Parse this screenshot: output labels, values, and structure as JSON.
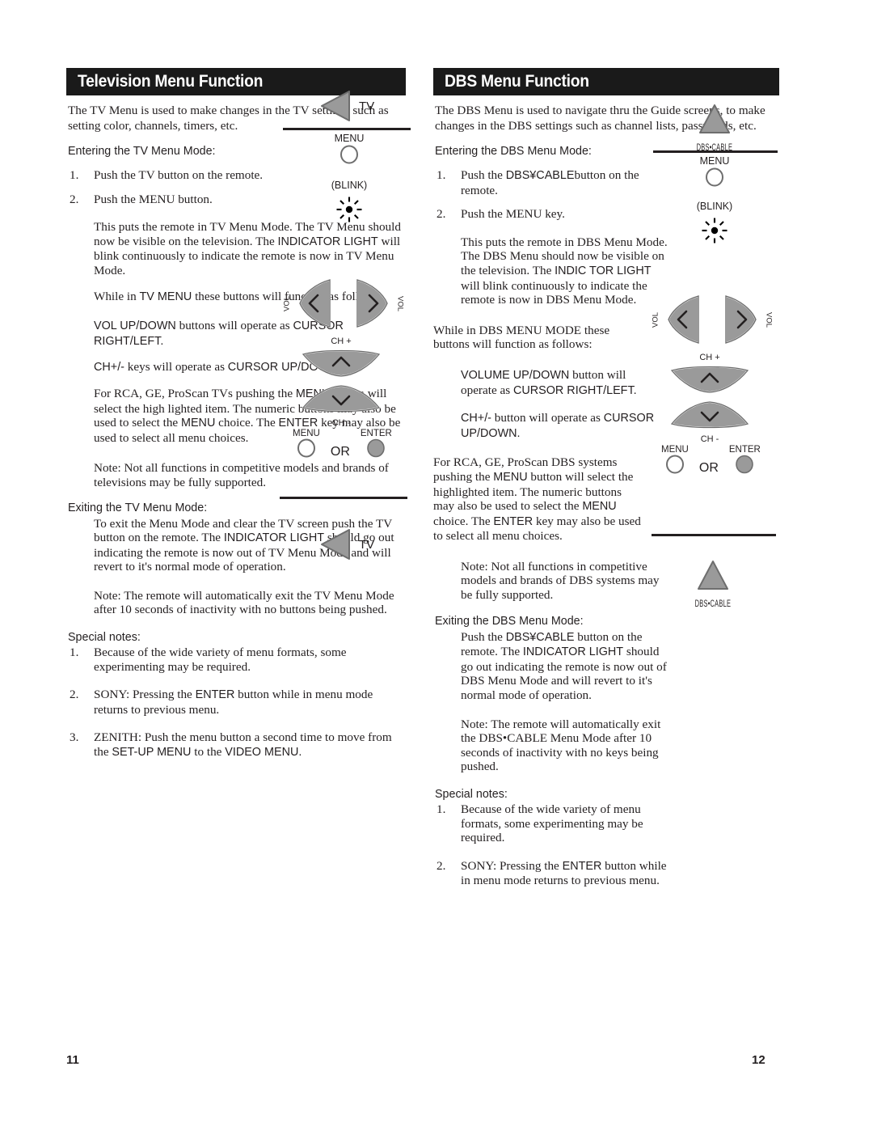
{
  "document": {
    "type": "remote-control-manual-spread"
  },
  "left_page": {
    "header": "Television Menu Function",
    "intro": "The TV Menu is used to make changes in the TV settings such as setting color, channels, timers, etc.",
    "entering_heading": "Entering the TV Menu Mode:",
    "step1_num": "1.",
    "step1": "Push the TV button on the remote.",
    "step2_num": "2.",
    "step2": "Push the MENU button.",
    "para_mode": "This puts the remote in TV Menu Mode. The TV  Menu should now be visible on the television. The ",
    "para_mode_b1": "INDICATOR LIGHT",
    "para_mode_cont": " will blink continuously to indicate the remote is now in TV Menu Mode.",
    "para_while_a": "While in ",
    "para_while_b": "TV MENU",
    "para_while_c": " these buttons will function as follows:",
    "para_vol_a": "VOL UP/DOWN",
    "para_vol_b": " buttons will operate as ",
    "para_vol_c": "CURSOR RIGHT/LEFT.",
    "para_ch_a": "CH+/-",
    "para_ch_b": " keys will operate as ",
    "para_ch_c": "CURSOR UP/DOWN.",
    "para_rca_1": "For RCA, GE, ProScan TVs pushing the ",
    "para_rca_menu": "MENU",
    "para_rca_2": " button will select the high lighted item. The numeric buttons may also be used to select the ",
    "para_rca_menu2": "MENU",
    "para_rca_3": " choice. The ",
    "para_rca_enter": "ENTER",
    "para_rca_4": " key may also be used to select all menu choices.",
    "note_support": "Note: Not all functions in competitive models and brands of televisions may be fully supported.",
    "exiting_heading": "Exiting the TV Menu Mode:",
    "exiting_1": "To exit the Menu Mode and clear the TV screen push the TV button on the remote. The ",
    "exiting_indic": "INDICATOR LIGHT",
    "exiting_2": " should go out indicating the remote is now out of TV Menu Mode and will revert to it's normal mode of operation.",
    "note_auto": "Note:  The remote will  automatically exit the TV Menu Mode after 10 seconds of inactivity with no buttons being pushed.",
    "special_heading": "Special notes:",
    "special": [
      {
        "num": "1.",
        "text": "Because of the wide variety of menu formats, some experimenting may be required."
      },
      {
        "num": "2.",
        "text_a": "SONY: Pressing the ",
        "text_b": "ENTER",
        "text_c": " button while in menu mode returns to previous menu."
      },
      {
        "num": "3.",
        "text_a": "ZENITH: Push the menu button a second time to move from the ",
        "text_b": "SET-UP MENU",
        "text_c": " to the ",
        "text_d": "VIDEO MENU."
      }
    ],
    "figures": {
      "tv_label": "TV",
      "menu_label": "MENU",
      "blink_label": "(BLINK)",
      "vol_left_label": "VOL",
      "vol_right_label": "VOL",
      "ch_up_label": "CH +",
      "ch_down_label": "CH -",
      "menu_btn_label": "MENU",
      "or_label": "OR",
      "enter_label": "ENTER",
      "tv_label_2": "TV"
    },
    "page_number": "11"
  },
  "right_page": {
    "header": "DBS Menu Function",
    "intro": "The DBS Menu is used to navigate thru the Guide screens, to make changes in the DBS settings such as channel lists, passwords, etc.",
    "entering_heading": "Entering  the DBS Menu Mode:",
    "step1_num": "1.",
    "step1_a": "Push the ",
    "step1_b": "DBS¥CABLE",
    "step1_c": "button on the remote.",
    "step2_num": "2.",
    "step2": "Push the MENU key.",
    "para_mode_a": "This puts the remote in DBS Menu Mode. The DBS Menu should now be visible on the television. The ",
    "para_mode_b": "INDIC TOR LIGHT",
    "para_mode_c": " will blink continuously  to indicate the  remote is now in DBS Menu Mode.",
    "para_while": "While in DBS MENU MODE these buttons will function as follows:",
    "para_vol_a": "VOLUME UP/DOWN",
    "para_vol_b": " button will operate as ",
    "para_vol_c": "CURSOR RIGHT/LEFT.",
    "para_ch_a": "CH+/-",
    "para_ch_b": " button will operate as ",
    "para_ch_c": "CURSOR UP/DOWN.",
    "para_rca_1": "For RCA, GE, ProScan DBS systems pushing the ",
    "para_rca_menu": "MENU",
    "para_rca_2": " button will select the highlighted item. The numeric buttons may also be used to select the ",
    "para_rca_menu2": "MENU",
    "para_rca_3": " choice. The ",
    "para_rca_enter": "ENTER",
    "para_rca_4": " key may also be used to select all menu choices.",
    "note_support": "Note: Not all functions in competitive models and brands of DBS systems may be fully supported.",
    "exiting_heading": "Exiting the DBS Menu Mode:",
    "exiting_1": "Push the ",
    "exiting_dbs": "DBS¥CABLE",
    "exiting_2": " button on the remote. The ",
    "exiting_indic": "INDICATOR LIGHT",
    "exiting_3": " should go out indicating the remote is now out of DBS Menu Mode and will revert to it's normal mode of operation.",
    "note_auto": "Note:  The remote will automatically exit the DBS•CABLE Menu Mode after 10 seconds of inactivity with no keys being pushed.",
    "special_heading": "Special notes:",
    "special": [
      {
        "num": "1.",
        "text": "Because of the wide variety of menu formats, some experimenting may be required."
      },
      {
        "num": "2.",
        "text_a": "SONY: Pressing the ",
        "text_b": "ENTER",
        "text_c": " button while in menu mode returns to previous menu."
      }
    ],
    "figures": {
      "dbs_cable_label": "DBS•CABLE",
      "menu_label": "MENU",
      "blink_label": "(BLINK)",
      "vol_left_label": "VOL",
      "vol_right_label": "VOL",
      "ch_up_label": "CH +",
      "ch_down_label": "CH -",
      "menu_btn_label": "MENU",
      "or_label": "OR",
      "enter_label": "ENTER",
      "dbs_cable_label_2": "DBS•CABLE"
    },
    "page_number": "12"
  },
  "colors": {
    "header_bg": "#1a1a1a",
    "header_text": "#ffffff",
    "body_text": "#231f20",
    "button_fill": "#9a9a9a",
    "button_stroke": "#6e6e6e"
  }
}
